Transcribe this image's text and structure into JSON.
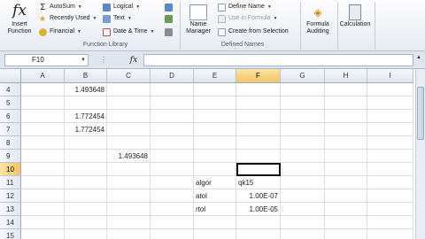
{
  "ribbon": {
    "insert_function": "Insert\nFunction",
    "autosum": "AutoSum",
    "recently_used": "Recently Used",
    "financial": "Financial",
    "logical": "Logical",
    "text": "Text",
    "date_time": "Date & Time",
    "function_library_label": "Function Library",
    "name_manager": "Name\nManager",
    "define_name": "Define Name",
    "use_in_formula": "Use in Formula",
    "create_from_selection": "Create from Selection",
    "defined_names_label": "Defined Names",
    "formula_auditing": "Formula\nAuditing",
    "calculation": "Calculation"
  },
  "formula_bar": {
    "name_box": "F10",
    "fx": "fx",
    "content": ""
  },
  "columns": [
    "A",
    "B",
    "C",
    "D",
    "E",
    "F",
    "G",
    "H",
    "I"
  ],
  "active_column": "F",
  "active_row": "10",
  "rows": [
    {
      "num": "4",
      "cells": {
        "B": "1.493648"
      }
    },
    {
      "num": "5",
      "cells": {}
    },
    {
      "num": "6",
      "cells": {
        "B": "1.772454"
      }
    },
    {
      "num": "7",
      "cells": {
        "B": "1.772454"
      }
    },
    {
      "num": "8",
      "cells": {}
    },
    {
      "num": "9",
      "cells": {
        "C": "1.493648"
      }
    },
    {
      "num": "10",
      "cells": {}
    },
    {
      "num": "11",
      "cells": {
        "E": "algor",
        "F": "qk15"
      }
    },
    {
      "num": "12",
      "cells": {
        "E": "atol",
        "F": "1.00E-07"
      }
    },
    {
      "num": "13",
      "cells": {
        "E": "rtol",
        "F": "1.00E-05"
      }
    },
    {
      "num": "14",
      "cells": {}
    },
    {
      "num": "15",
      "cells": {}
    }
  ]
}
